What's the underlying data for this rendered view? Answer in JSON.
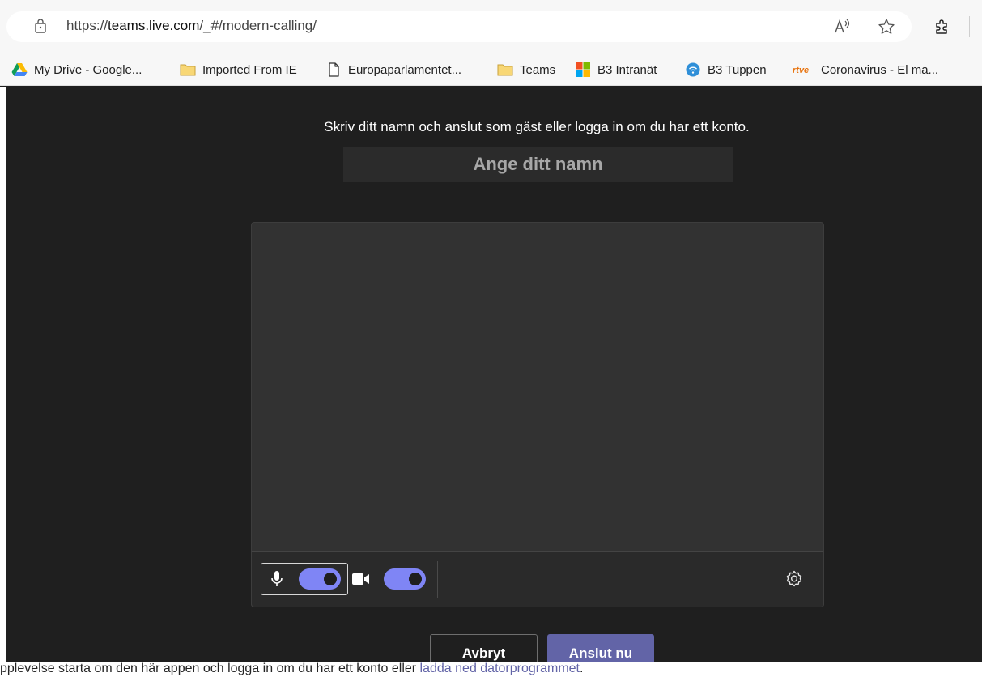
{
  "browser": {
    "url_prefix": "https://",
    "url_host": "teams.live.com",
    "url_path": "/_#/modern-calling/",
    "icons": [
      "page-info-icon",
      "read-aloud-icon",
      "favorite-star-icon",
      "extensions-icon"
    ]
  },
  "bookmarks": [
    {
      "label": "My Drive - Google...",
      "icon": "google-drive-icon"
    },
    {
      "label": "Imported From IE",
      "icon": "folder-icon"
    },
    {
      "label": "Europaparlamentet...",
      "icon": "page-icon"
    },
    {
      "label": "Teams",
      "icon": "folder-icon"
    },
    {
      "label": "B3 Intranät",
      "icon": "microsoft-logo-icon"
    },
    {
      "label": "B3 Tuppen",
      "icon": "wifi-icon"
    },
    {
      "label": "Coronavirus - El ma...",
      "icon": "rtve-logo-icon"
    }
  ],
  "join": {
    "instruction": "Skriv ditt namn och anslut som gäst eller logga in om du har ett konto.",
    "name_placeholder": "Ange ditt namn",
    "mic_on": true,
    "camera_on": true,
    "cancel_label": "Avbryt",
    "join_label": "Anslut nu"
  },
  "footer": {
    "text": "pplevelse starta om den här appen och logga in om du har ett konto eller ",
    "link": "ladda ned datorprogrammet",
    "end": "."
  },
  "colors": {
    "accent": "#6264a7",
    "toggle_on": "#7f85f5",
    "background": "#1f1f1f",
    "preview": "#323232"
  }
}
